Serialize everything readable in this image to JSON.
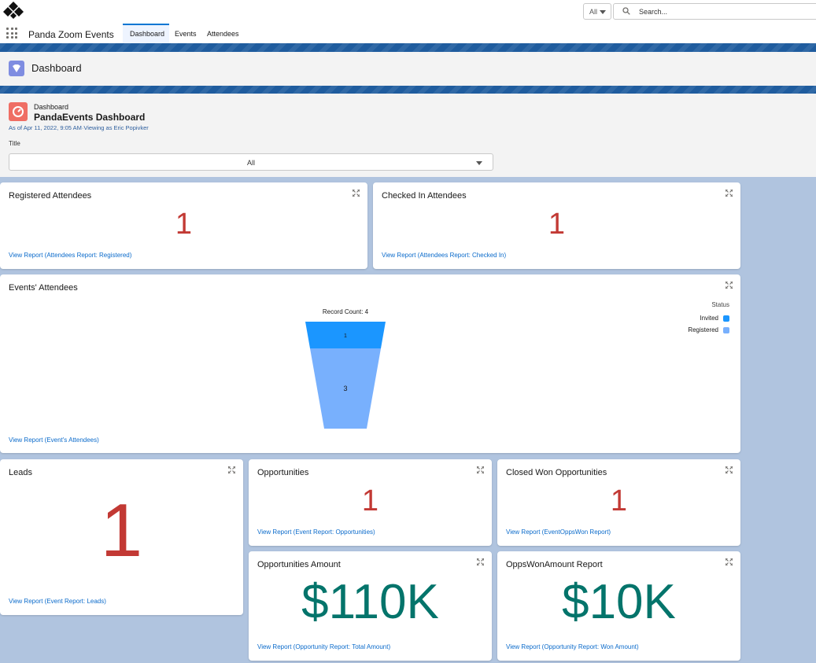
{
  "search": {
    "scope": "All",
    "placeholder": "Search..."
  },
  "nav": {
    "app_name": "Panda Zoom Events",
    "tabs": [
      {
        "label": "Dashboard",
        "active": true
      },
      {
        "label": "Events",
        "active": false
      },
      {
        "label": "Attendees",
        "active": false
      }
    ]
  },
  "page_header": {
    "title": "Dashboard"
  },
  "dashboard": {
    "object_label": "Dashboard",
    "name": "PandaEvents Dashboard",
    "meta": "As of Apr 11, 2022, 9:05 AM·Viewing as Eric Popivker",
    "filter_label": "Title",
    "filter_value": "All"
  },
  "cards": {
    "registered": {
      "title": "Registered Attendees",
      "value": "1",
      "link": "View Report (Attendees Report: Registered)"
    },
    "checked_in": {
      "title": "Checked In Attendees",
      "value": "1",
      "link": "View Report (Attendees Report: Checked In)"
    },
    "events_attendees": {
      "title": "Events' Attendees",
      "link": "View Report (Event's Attendees)"
    },
    "leads": {
      "title": "Leads",
      "value": "1",
      "link": "View Report (Event Report: Leads)"
    },
    "opportunities": {
      "title": "Opportunities",
      "value": "1",
      "link": "View Report (Event Report: Opportunities)"
    },
    "closed_won": {
      "title": "Closed Won Opportunities",
      "value": "1",
      "link": "View Report (EventOppsWon Report)"
    },
    "opp_amount": {
      "title": "Opportunities Amount",
      "value": "$110K",
      "link": "View Report (Opportunity Report: Total Amount)"
    },
    "opps_won_amount": {
      "title": "OppsWonAmount Report",
      "value": "$10K",
      "link": "View Report (Opportunity Report: Won Amount)"
    }
  },
  "chart_data": {
    "type": "funnel",
    "title": "Record Count: 4",
    "legend_title": "Status",
    "legend_position": "top-right",
    "categories": [
      "Invited",
      "Registered"
    ],
    "values": [
      1,
      3
    ],
    "colors": [
      "#1b96ff",
      "#78b0fd"
    ]
  },
  "colors": {
    "metric_red": "#c23934",
    "metric_green": "#04746b",
    "link": "#0b6bcb"
  }
}
